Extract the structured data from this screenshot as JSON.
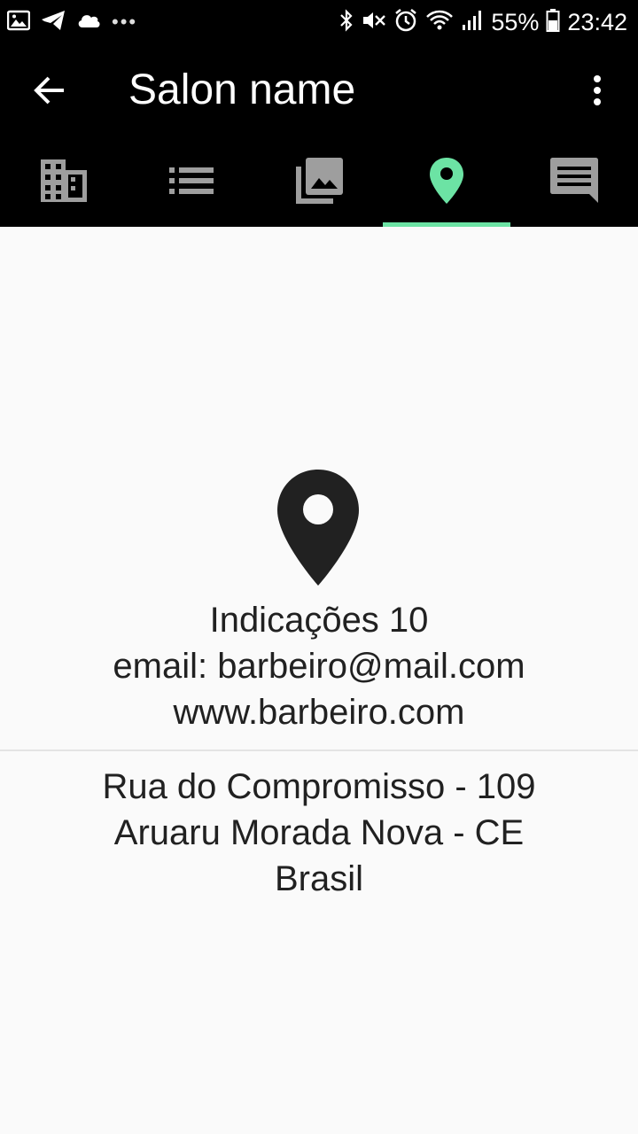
{
  "status_bar": {
    "battery": "55%",
    "time": "23:42",
    "left_icons": [
      "image-icon",
      "telegram-icon",
      "cloud-icon",
      "more-dots"
    ],
    "right_icons": [
      "bluetooth-icon",
      "mute-icon",
      "alarm-icon",
      "wifi-icon",
      "signal-icon",
      "battery-icon"
    ]
  },
  "app_bar": {
    "title": "Salon name",
    "back_icon": "arrow-back-icon",
    "menu_icon": "more-vert-icon"
  },
  "tabs": [
    {
      "icon": "building-icon",
      "active": false
    },
    {
      "icon": "list-icon",
      "active": false
    },
    {
      "icon": "photo-library-icon",
      "active": false
    },
    {
      "icon": "location-pin-icon",
      "active": true
    },
    {
      "icon": "chat-icon",
      "active": false
    }
  ],
  "colors": {
    "accent": "#6ce3a4",
    "bar_background": "#000000",
    "inactive_icon": "#9e9e9e",
    "content_background": "#fafafa",
    "text": "#212121"
  },
  "details": {
    "indications": "Indicações 10",
    "email": "email: barbeiro@mail.com",
    "website": "www.barbeiro.com"
  },
  "address": {
    "street": "Rua do Compromisso - 109",
    "city": "Aruaru Morada Nova - CE",
    "country": "Brasil"
  }
}
